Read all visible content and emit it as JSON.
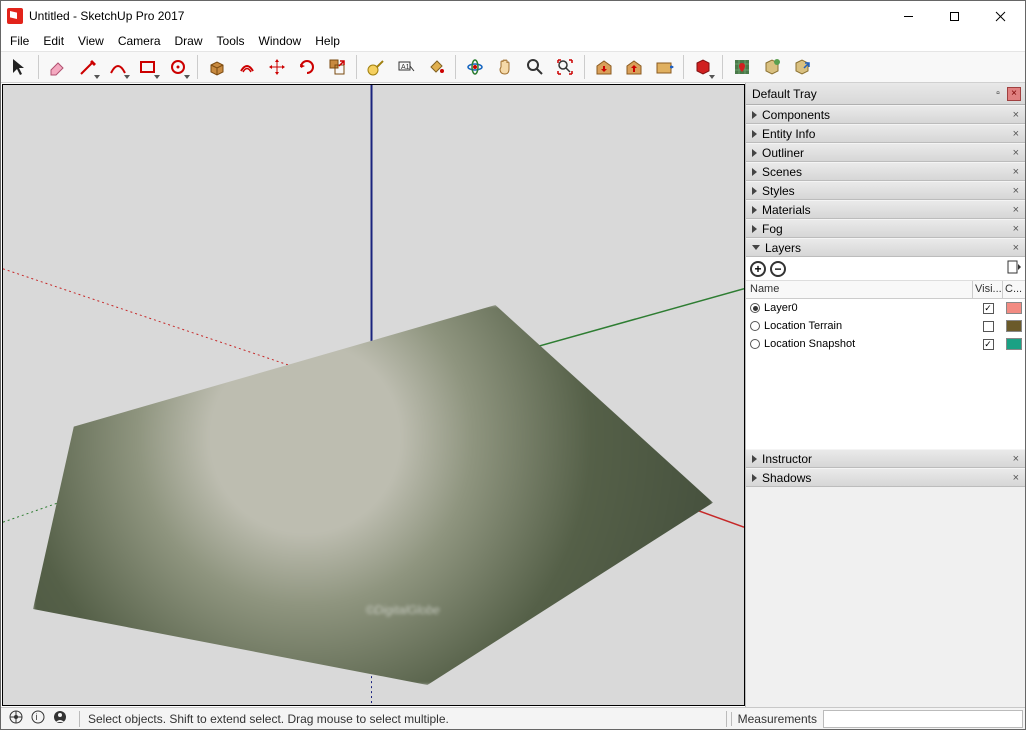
{
  "title": "Untitled - SketchUp Pro 2017",
  "menus": [
    "File",
    "Edit",
    "View",
    "Camera",
    "Draw",
    "Tools",
    "Window",
    "Help"
  ],
  "tray": {
    "title": "Default Tray",
    "panels": [
      {
        "label": "Components",
        "open": false
      },
      {
        "label": "Entity Info",
        "open": false
      },
      {
        "label": "Outliner",
        "open": false
      },
      {
        "label": "Scenes",
        "open": false
      },
      {
        "label": "Styles",
        "open": false
      },
      {
        "label": "Materials",
        "open": false
      },
      {
        "label": "Fog",
        "open": false
      },
      {
        "label": "Layers",
        "open": true
      },
      {
        "label": "Instructor",
        "open": false
      },
      {
        "label": "Shadows",
        "open": false
      }
    ],
    "layers": {
      "cols": {
        "name": "Name",
        "vis": "Visi...",
        "color": "C..."
      },
      "rows": [
        {
          "name": "Layer0",
          "active": true,
          "visible": true,
          "color": "#f28b82"
        },
        {
          "name": "Location Terrain",
          "active": false,
          "visible": false,
          "color": "#6b5a2a"
        },
        {
          "name": "Location Snapshot",
          "active": false,
          "visible": true,
          "color": "#1aa184"
        }
      ]
    }
  },
  "status": {
    "hint": "Select objects. Shift to extend select. Drag mouse to select multiple.",
    "measurements_label": "Measurements"
  },
  "watermark": "©DigitalGlobe"
}
